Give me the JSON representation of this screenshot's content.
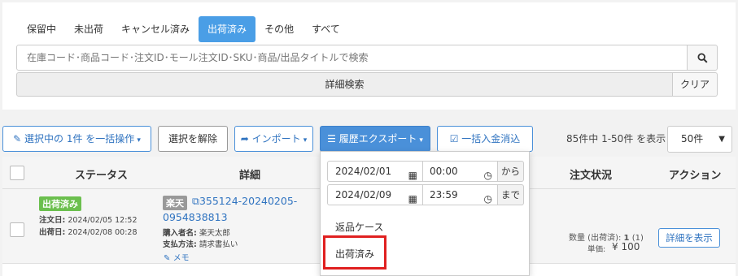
{
  "tabs": [
    "保留中",
    "未出荷",
    "キャンセル済み",
    "出荷済み",
    "その他",
    "すべて"
  ],
  "active_tab_index": 3,
  "search": {
    "placeholder": "在庫コード･商品コード･注文ID･モール注文ID･SKU･商品/出品タイトルで検索",
    "icon": "search-icon"
  },
  "detail_search_label": "詳細検索",
  "clear_label": "クリア",
  "toolbar": {
    "bulk_label": "選択中の 1件 を一括操作",
    "deselect_label": "選択を解除",
    "import_label": "インポート",
    "export_label": "履歴エクスポート",
    "payment_label": "一括入金消込"
  },
  "count_text": "85件中 1-50件 を表示",
  "per_page": "50件",
  "table": {
    "headers": {
      "status": "ステータス",
      "detail": "詳細",
      "order_status": "注文状況",
      "action": "アクション"
    }
  },
  "row": {
    "status_badge": "出荷済み",
    "order_date_label": "注文日:",
    "order_date": "2024/02/05 12:52",
    "ship_date_label": "出荷日:",
    "ship_date": "2024/02/08 00:28",
    "mall_badge": "楽天",
    "order_id_line1": "355124-20240205-",
    "order_id_line2": "0954838813",
    "buyer_label": "購入者名:",
    "buyer": "楽天太郎",
    "payment_label": "支払方法:",
    "payment": "請求書払い",
    "memo_label": "メモ",
    "qty_label": "数量 (出荷済):",
    "qty_value": "1",
    "qty_shipped": "(1)",
    "price_label": "単価:",
    "price_value": "¥ 100",
    "view_label": "詳細を表示"
  },
  "dropdown": {
    "from_date": "2024/02/01",
    "from_time": "00:00",
    "from_label": "から",
    "to_date": "2024/02/09",
    "to_time": "23:59",
    "to_label": "まで",
    "items": [
      "返品ケース",
      "出荷済み"
    ]
  },
  "colors": {
    "accent": "#4a90d9",
    "tab_active": "#4a9ee6",
    "shipped_badge": "#6bbf4e",
    "highlight": "#e02020"
  }
}
